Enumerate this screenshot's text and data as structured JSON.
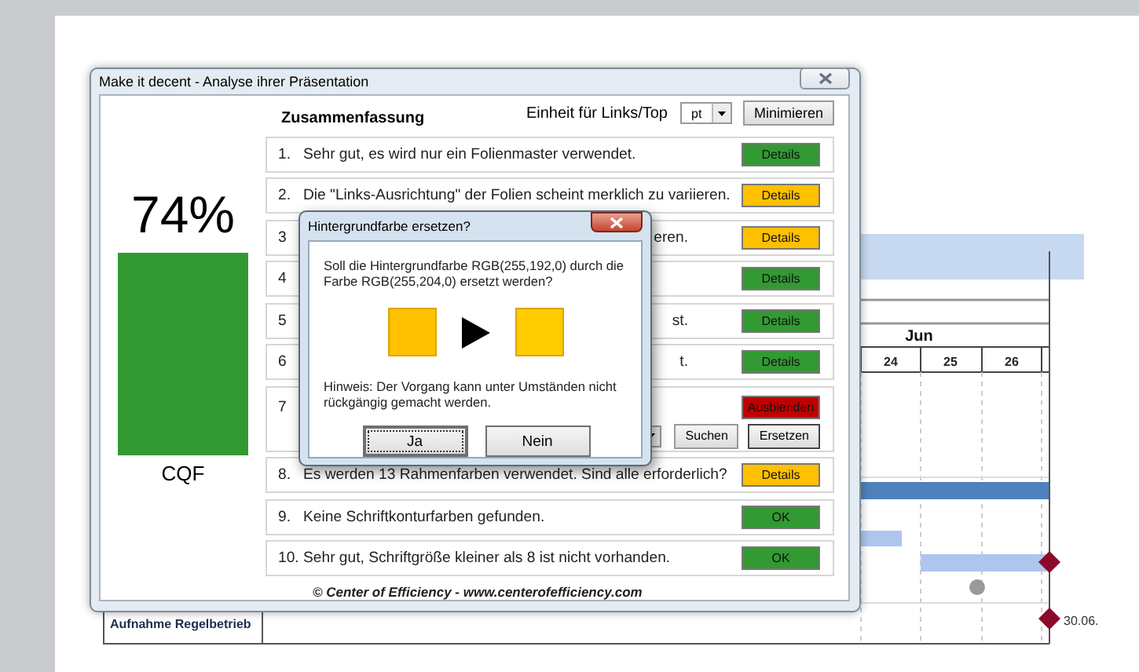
{
  "slide": {
    "gantt": {
      "month": "Jun",
      "days": [
        "24",
        "25",
        "26"
      ],
      "milestone_label": "30.06.",
      "task_label": "Aufnahme Regelbetrieb"
    }
  },
  "window": {
    "title": "Make it decent - Analyse ihrer Präsentation",
    "score": "74%",
    "score_label": "CQF",
    "summary_title": "Zusammenfassung",
    "unit_label": "Einheit für Links/Top",
    "unit_value": "pt",
    "minimize_button": "Minimieren",
    "items": [
      {
        "kind": "full",
        "number": "1.",
        "text": "Sehr gut, es wird nur ein Folienmaster verwendet.",
        "button": "Details",
        "color": "#339933"
      },
      {
        "kind": "full",
        "number": "2.",
        "text": "Die \"Links-Ausrichtung\" der Folien scheint merklich zu variieren.",
        "button": "Details",
        "color": "#ffc000"
      },
      {
        "kind": "covered",
        "number": "3",
        "text": "eren.",
        "button": "Details",
        "color": "#ffc000"
      },
      {
        "kind": "covered",
        "number": "4",
        "button": "Details",
        "color": "#339933"
      },
      {
        "kind": "covered",
        "number": "5",
        "text": "st.",
        "button": "Details",
        "color": "#339933"
      },
      {
        "kind": "covered",
        "number": "6",
        "text": "t.",
        "button": "Details",
        "color": "#339933"
      },
      {
        "kind": "replace",
        "number": "7",
        "button": "Ausblenden",
        "color": "#c00000",
        "actions": [
          "Suchen",
          "Ersetzen"
        ]
      },
      {
        "kind": "full",
        "number": "8.",
        "text": "Es werden 13 Rahmenfarben verwendet. Sind alle erforderlich?",
        "button": "Details",
        "color": "#ffc000"
      },
      {
        "kind": "full",
        "number": "9.",
        "text": "Keine Schriftkonturfarben gefunden.",
        "button": "OK",
        "color": "#339933"
      },
      {
        "kind": "full",
        "number": "10.",
        "text": "Sehr gut, Schriftgröße kleiner als 8 ist nicht vorhanden.",
        "button": "OK",
        "color": "#339933"
      }
    ],
    "footer": "© Center of Efficiency - www.centerofefficiency.com"
  },
  "dialog": {
    "title": "Hintergrundfarbe ersetzen?",
    "question": "Soll die Hintergrundfarbe RGB(255,192,0) durch die Farbe RGB(255,204,0) ersetzt werden?",
    "swatches": [
      {
        "color": "#ffc000"
      },
      {
        "color": "#ffcc00"
      }
    ],
    "hint": "Hinweis: Der Vorgang kann unter Umständen nicht rückgängig gemacht werden.",
    "buttons": [
      {
        "label": "Ja",
        "selected": true
      },
      {
        "label": "Nein",
        "selected": false
      }
    ]
  }
}
